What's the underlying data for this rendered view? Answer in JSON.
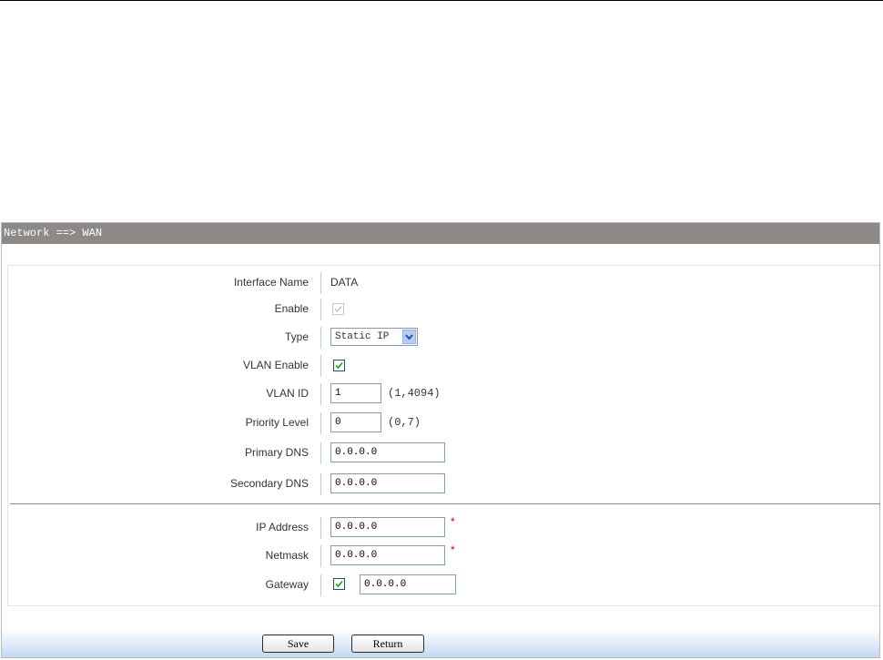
{
  "title": "Network ==> WAN",
  "fields": {
    "interface_name": {
      "label": "Interface Name",
      "value": "DATA"
    },
    "enable": {
      "label": "Enable",
      "checked": true,
      "disabled": true
    },
    "type": {
      "label": "Type",
      "value": "Static IP"
    },
    "vlan_enable": {
      "label": "VLAN Enable",
      "checked": true
    },
    "vlan_id": {
      "label": "VLAN ID",
      "value": "1",
      "hint": "(1,4094)"
    },
    "priority_level": {
      "label": "Priority Level",
      "value": "0",
      "hint": "(0,7)"
    },
    "primary_dns": {
      "label": "Primary DNS",
      "value": "0.0.0.0"
    },
    "secondary_dns": {
      "label": "Secondary DNS",
      "value": "0.0.0.0"
    },
    "ip_address": {
      "label": "IP Address",
      "value": "0.0.0.0",
      "required_mark": "*"
    },
    "netmask": {
      "label": "Netmask",
      "value": "0.0.0.0",
      "required_mark": "*"
    },
    "gateway": {
      "label": "Gateway",
      "checked": true,
      "value": "0.0.0.0"
    }
  },
  "buttons": {
    "save": "Save",
    "return": "Return"
  },
  "colors": {
    "titlebar": "#8c8987",
    "footer_gradient_end": "#c4d8f2",
    "required": "#e00000"
  }
}
